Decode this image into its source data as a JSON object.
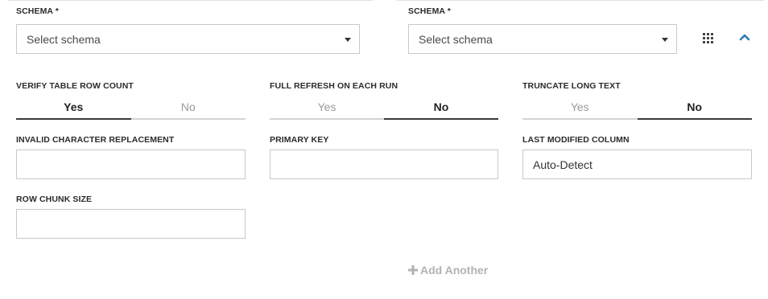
{
  "schema_left": {
    "label": "SCHEMA *",
    "selected": "Select schema"
  },
  "schema_right": {
    "label": "SCHEMA *",
    "selected": "Select schema"
  },
  "row1": {
    "verify": {
      "label": "VERIFY TABLE ROW COUNT",
      "yes": "Yes",
      "no": "No",
      "selected": "Yes"
    },
    "full_refresh": {
      "label": "FULL REFRESH ON EACH RUN",
      "yes": "Yes",
      "no": "No",
      "selected": "No"
    },
    "truncate": {
      "label": "TRUNCATE LONG TEXT",
      "yes": "Yes",
      "no": "No",
      "selected": "No"
    }
  },
  "row2": {
    "invalid_char": {
      "label": "INVALID CHARACTER REPLACEMENT",
      "value": ""
    },
    "primary_key": {
      "label": "PRIMARY KEY",
      "value": ""
    },
    "last_modified": {
      "label": "LAST MODIFIED COLUMN",
      "value": "Auto-Detect"
    }
  },
  "row3": {
    "row_chunk": {
      "label": "ROW CHUNK SIZE",
      "value": ""
    }
  },
  "add_another": {
    "icon": "plus-icon",
    "label": "Add Another"
  },
  "icons": {
    "grid": "grid-icon",
    "collapse": "chevron-up-icon"
  },
  "colors": {
    "accent": "#2a7ab8",
    "muted": "#b3b3b3"
  }
}
